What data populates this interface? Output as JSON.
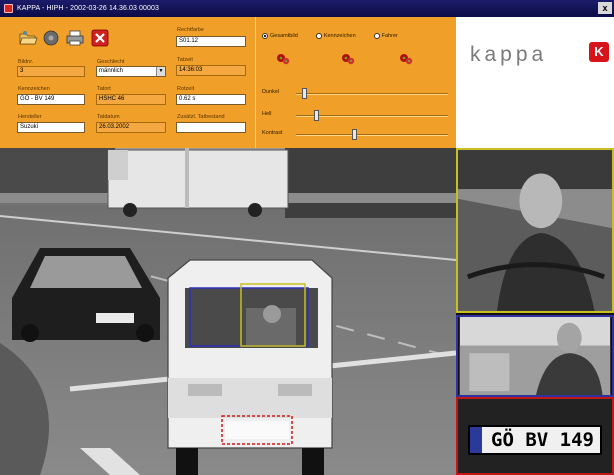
{
  "window": {
    "title": "KAPPA - HIPH - 2002-03-26 14.36.03 00003",
    "close_glyph": "x"
  },
  "toolbar": {
    "icons": [
      "open-folder-icon",
      "gear-icon",
      "print-icon",
      "delete-icon"
    ]
  },
  "fields": {
    "bildnr": {
      "label": "Bildnr.",
      "value": "3"
    },
    "geschlecht": {
      "label": "Geschlecht",
      "value": "männlich"
    },
    "kennzeichen": {
      "label": "Kennzeichen",
      "value": "GÖ - BV 149"
    },
    "tatort": {
      "label": "Tatort",
      "value": "HSHC 46"
    },
    "hersteller": {
      "label": "Hersteller",
      "value": "Suzuki"
    },
    "tatdatum": {
      "label": "Tatdatum",
      "value": "26.03.2002"
    },
    "rechtsfarbe": {
      "label": "Rechtfarbe",
      "value": "S01.12"
    },
    "tatzeit": {
      "label": "Tatzeit",
      "value": "14:36:03"
    },
    "rotzeit": {
      "label": "Rotzeit",
      "value": "0.62 s"
    },
    "zusatz": {
      "label": "Zusätzl. Tatbestand",
      "value": ""
    }
  },
  "view_modes": {
    "options": [
      "Gesamtbild",
      "Kennzeichen",
      "Fahrer"
    ],
    "selected": "Gesamtbild"
  },
  "adjustments": {
    "dunkel": {
      "label": "Dunkel",
      "value": 0.04
    },
    "hell": {
      "label": "Hell",
      "value": 0.12
    },
    "kontrast": {
      "label": "Kontrast",
      "value": 0.38
    }
  },
  "logo": {
    "text": "kappa",
    "badge": "K"
  },
  "plate_zoom": {
    "text": "GÖ BV 149"
  },
  "colors": {
    "panel": "#f0a028",
    "titlebar": "#0c0c48",
    "driver_box": "#c8c020",
    "passenger_box": "#3030a0",
    "plate_box": "#c01818"
  }
}
